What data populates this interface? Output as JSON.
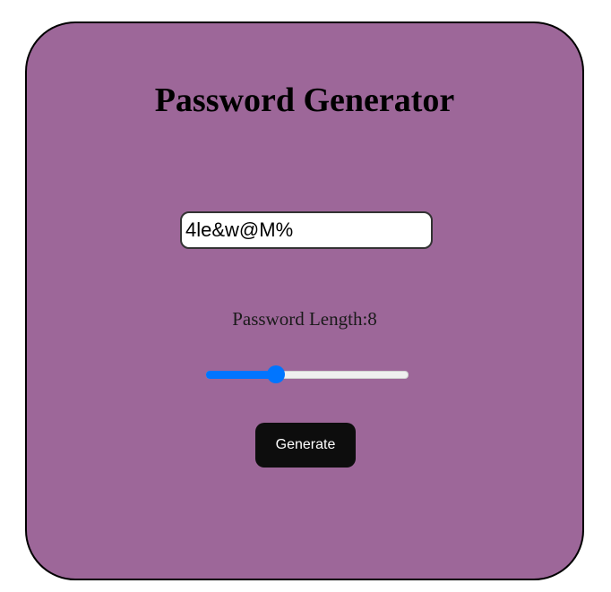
{
  "app": {
    "title": "Password Generator"
  },
  "password": {
    "value": "4le&w@M%"
  },
  "length": {
    "label": "Password Length:",
    "value": "8",
    "slider_fraction": 0.35
  },
  "actions": {
    "generate_label": "Generate"
  },
  "colors": {
    "card_background": "#9d6799",
    "accent": "#0075ff",
    "button_background": "#0d0d0d"
  }
}
